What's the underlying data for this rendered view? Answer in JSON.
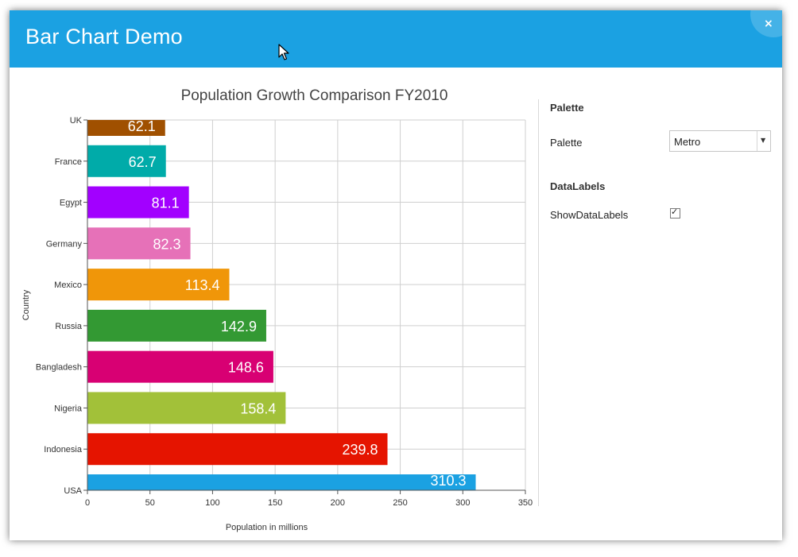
{
  "window": {
    "title": "Bar Chart Demo",
    "close_glyph": "×",
    "accent": "#1ba1e2"
  },
  "panel": {
    "palette_heading": "Palette",
    "palette_label": "Palette",
    "palette_value": "Metro",
    "datalabels_heading": "DataLabels",
    "show_datalabels_label": "ShowDataLabels",
    "show_datalabels_checked": true
  },
  "chart_data": {
    "type": "bar",
    "orientation": "horizontal",
    "title": "Population Growth Comparison FY2010",
    "xlabel": "Population in millions",
    "ylabel": "Country",
    "xlim": [
      0,
      350
    ],
    "xticks": [
      0,
      50,
      100,
      150,
      200,
      250,
      300,
      350
    ],
    "grid": true,
    "categories": [
      "UK",
      "France",
      "Egypt",
      "Germany",
      "Mexico",
      "Russia",
      "Bangladesh",
      "Nigeria",
      "Indonesia",
      "USA"
    ],
    "values": [
      62.1,
      62.7,
      81.1,
      82.3,
      113.4,
      142.9,
      148.6,
      158.4,
      239.8,
      310.3
    ],
    "labels": [
      "62.1",
      "62.7",
      "81.1",
      "82.3",
      "113.4",
      "142.9",
      "148.6",
      "158.4",
      "239.8",
      "310.3"
    ],
    "colors": [
      "#a05000",
      "#00aba9",
      "#a200ff",
      "#e671b8",
      "#f09609",
      "#339933",
      "#d80073",
      "#a2c139",
      "#e51400",
      "#1ba1e2"
    ]
  }
}
